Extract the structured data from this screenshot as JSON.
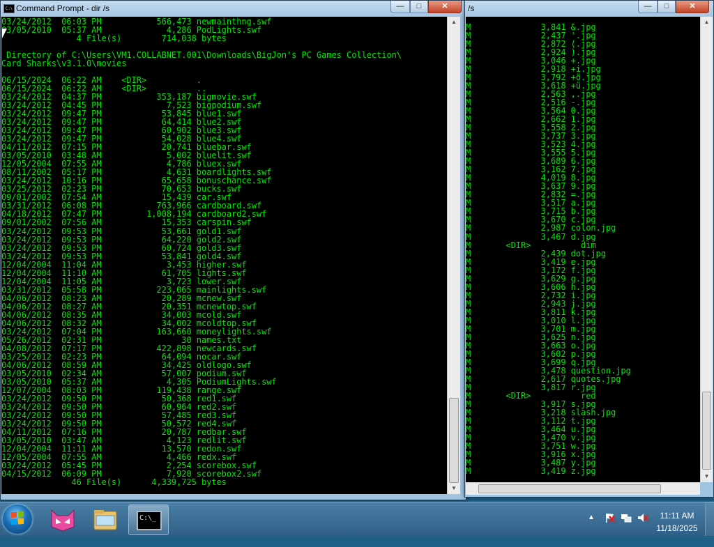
{
  "left_window": {
    "title": "Command Prompt - dir /s",
    "icon_text": "C:\\",
    "lines": [
      "03/24/2012  06:03 PM           566,473 newmainthng.swf",
      "03/05/2010  05:37 AM             4,286 PodLights.swf",
      "               4 File(s)        714,038 bytes",
      "",
      " Directory of C:\\Users\\VM1.COLLABNET.001\\Downloads\\BigJon's PC Games Collection\\",
      "Card Sharks\\v3.1.0\\movies",
      "",
      "06/15/2024  06:22 AM    <DIR>          .",
      "06/15/2024  06:22 AM    <DIR>          ..",
      "03/24/2012  04:37 PM           353,187 bigmovie.swf",
      "03/24/2012  04:45 PM             7,523 bigpodium.swf",
      "03/24/2012  09:47 PM            53,845 blue1.swf",
      "03/24/2012  09:47 PM            64,414 blue2.swf",
      "03/24/2012  09:47 PM            60,902 blue3.swf",
      "03/24/2012  09:47 PM            54,028 blue4.swf",
      "04/11/2012  07:15 PM            20,741 bluebar.swf",
      "03/05/2010  03:48 AM             5,002 bluelit.swf",
      "12/05/2004  07:55 AM             4,786 bluex.swf",
      "08/11/2002  05:17 PM             4,631 boardlights.swf",
      "03/24/2012  10:16 PM            65,658 bonuschance.swf",
      "03/25/2012  02:23 PM            70,653 bucks.swf",
      "09/01/2002  07:54 AM            15,439 car.swf",
      "03/31/2012  06:08 PM           763,966 cardboard.swf",
      "04/18/2012  07:47 PM         1,008,194 cardboard2.swf",
      "09/01/2002  07:56 AM            15,353 carspin.swf",
      "03/24/2012  09:53 PM            53,661 gold1.swf",
      "03/24/2012  09:53 PM            64,220 gold2.swf",
      "03/24/2012  09:53 PM            60,724 gold3.swf",
      "03/24/2012  09:53 PM            53,841 gold4.swf",
      "12/04/2004  11:04 AM             3,453 higher.swf",
      "12/04/2004  11:10 AM            61,705 lights.swf",
      "12/04/2004  11:05 AM             3,723 lower.swf",
      "03/31/2012  05:58 PM           223,065 mainlights.swf",
      "04/06/2012  08:23 AM            20,289 mcnew.swf",
      "04/06/2012  08:27 AM            20,351 mcnewtop.swf",
      "04/06/2012  08:35 AM            34,003 mcold.swf",
      "04/06/2012  08:32 AM            34,002 mcoldtop.swf",
      "03/24/2012  07:04 PM           163,660 moneylights.swf",
      "05/26/2012  02:31 PM                30 names.txt",
      "04/08/2012  07:17 PM           422,898 newcards.swf",
      "03/25/2012  02:23 PM            64,094 nocar.swf",
      "04/06/2012  08:59 AM            34,425 oldlogo.swf",
      "03/05/2010  02:34 AM            57,007 podium.swf",
      "03/05/2010  05:37 AM             4,305 PodiumLights.swf",
      "12/07/2004  08:03 PM           119,438 range.swf",
      "03/24/2012  09:50 PM            50,368 red1.swf",
      "03/24/2012  09:50 PM            60,964 red2.swf",
      "03/24/2012  09:50 PM            57,485 red3.swf",
      "03/24/2012  09:50 PM            50,572 red4.swf",
      "04/11/2012  07:16 PM            20,787 redbar.swf",
      "03/05/2010  03:47 AM             4,123 redlit.swf",
      "12/04/2004  11:11 AM            13,570 redon.swf",
      "12/05/2004  07:55 AM             4,466 redx.swf",
      "03/24/2012  05:45 PM             2,254 scorebox.swf",
      "04/15/2012  06:09 PM             7,920 scorebox2.swf",
      "              46 File(s)      4,339,725 bytes"
    ]
  },
  "right_window": {
    "title": "/s",
    "lines": [
      "M              3,841 &.jpg",
      "M              2,437 '.jpg",
      "M              2,872 (.jpg",
      "M              2,924 ).jpg",
      "M              3,046 +.jpg",
      "M              2,918 +i.jpg",
      "M              3,792 +ö.jpg",
      "M              3,618 +ü.jpg",
      "M              2,563 ,.jpg",
      "M              2,516 -.jpg",
      "M              3,564 0.jpg",
      "M              2,662 1.jpg",
      "M              3,558 2.jpg",
      "M              3,737 3.jpg",
      "M              3,523 4.jpg",
      "M              3,555 5.jpg",
      "M              3,689 6.jpg",
      "M              3,162 7.jpg",
      "M              4,019 8.jpg",
      "M              3,637 9.jpg",
      "M              2,832 =.jpg",
      "M              3,517 a.jpg",
      "M              3,715 b.jpg",
      "M              3,670 c.jpg",
      "M              2,987 colon.jpg",
      "M              3,467 d.jpg",
      "M       <DIR>          dim",
      "M              2,439 dot.jpg",
      "M              3,419 e.jpg",
      "M              3,172 f.jpg",
      "M              3,629 g.jpg",
      "M              3,606 h.jpg",
      "M              2,732 i.jpg",
      "M              2,943 j.jpg",
      "M              3,811 k.jpg",
      "M              3,010 l.jpg",
      "M              3,701 m.jpg",
      "M              3,625 n.jpg",
      "M              3,663 o.jpg",
      "M              3,602 p.jpg",
      "M              3,699 q.jpg",
      "M              3,478 question.jpg",
      "M              2,617 quotes.jpg",
      "M              3,817 r.jpg",
      "M       <DIR>          red",
      "M              3,917 s.jpg",
      "M              3,218 slash.jpg",
      "M              3,112 t.jpg",
      "M              3,464 u.jpg",
      "M              3,470 v.jpg",
      "M              3,751 w.jpg",
      "M              3,916 x.jpg",
      "M              3,487 y.jpg",
      "M              3,419 z.jpg"
    ]
  },
  "window_buttons": {
    "minimize": "—",
    "maximize": "□",
    "close": "✕"
  },
  "taskbar": {
    "pinned": [
      {
        "name": "start-button",
        "icon": "windows-logo-icon"
      },
      {
        "name": "cat-app",
        "icon": "cat-face-icon"
      },
      {
        "name": "explorer",
        "icon": "folder-icon"
      },
      {
        "name": "command-prompt",
        "icon": "console-icon"
      }
    ],
    "cmd_icon_text": "C:\\_",
    "tray_arrow": "▲",
    "clock_time": "11:11 AM",
    "clock_date": "11/18/2025"
  },
  "colors": {
    "console_text": "#00e600",
    "console_bg": "#000000",
    "taskbar": "#2f5f86",
    "titlebar": "#a6c6e3"
  }
}
